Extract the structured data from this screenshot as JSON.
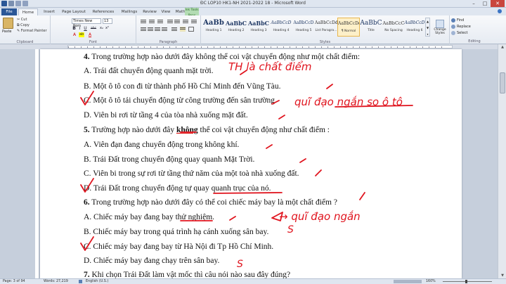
{
  "window": {
    "title": "ĐC LOP10 HK1-NH 2021-2022 18  -  Microsoft Word",
    "minimize": "–",
    "maximize": "□",
    "close": "✕"
  },
  "tabs": {
    "file": "File",
    "home": "Home",
    "insert": "Insert",
    "page_layout": "Page Layout",
    "references": "References",
    "mailings": "Mailings",
    "review": "Review",
    "view": "View",
    "mathtype": "MathType",
    "ink_tools": "Ink Tools",
    "pens": "Pens"
  },
  "ribbon": {
    "clipboard": {
      "paste": "Paste",
      "cut": "Cut",
      "copy": "Copy",
      "format_painter": "Format Painter",
      "label": "Clipboard"
    },
    "font": {
      "family": "Times New Rom",
      "size": "13",
      "label": "Font",
      "buttons": [
        "B",
        "I",
        "U",
        "abc",
        "x₂",
        "x²"
      ],
      "buttons2": [
        "A",
        "ab",
        "A"
      ]
    },
    "paragraph": {
      "label": "Paragraph"
    },
    "styles": {
      "label": "Styles",
      "items": [
        {
          "prev": "AaBb",
          "name": "Heading 1"
        },
        {
          "prev": "AaBbC",
          "name": "Heading 2"
        },
        {
          "prev": "AaBbC",
          "name": "Heading 3"
        },
        {
          "prev": "AaBbCcD",
          "name": "Heading 4"
        },
        {
          "prev": "AaBbCcD",
          "name": "Heading 5"
        },
        {
          "prev": "AaBbCcDd",
          "name": "List Paragra..."
        },
        {
          "prev": "AaBbCcDd",
          "name": "¶ Normal"
        },
        {
          "prev": "AaBbC",
          "name": "Title"
        },
        {
          "prev": "AaBbCcC",
          "name": "No Spacing"
        },
        {
          "prev": "AaBbCcD",
          "name": "Heading 6"
        }
      ],
      "change_styles": "Change Styles"
    },
    "editing": {
      "label": "Editing",
      "find": "Find",
      "replace": "Replace",
      "select": "Select"
    }
  },
  "document": {
    "lines": [
      {
        "prefix": "4.",
        "text": "  Trong trường hợp nào dưới đây không thể coi vật chuyển động như một chất điểm:"
      },
      {
        "text": "A. Trái đất chuyển động quanh mặt trời."
      },
      {
        "text": "B. Một ô tô con đi từ thành phố Hồ Chí Minh đến Vũng Tàu."
      },
      {
        "text": "C. Một ô tô tải chuyển động từ công trường đến sân trường."
      },
      {
        "text": "D. Viên bi rơi từ tầng 4 của tòa nhà xuống mặt đất."
      },
      {
        "prefix": "5.",
        "text_before": "  Trường hợp nào dưới đây ",
        "emph": "không",
        "text_after": " thể coi vật chuyển động như chất  điểm :"
      },
      {
        "text": "A. Viên đạn đang chuyển động trong không khí."
      },
      {
        "text": "B. Trái Đất trong chuyển động quay quanh Mặt Trời."
      },
      {
        "text": "C. Viên bi trong sự rơi từ tầng thứ năm của một toà nhà xuống đất."
      },
      {
        "text": "D. Trái Đất trong chuyển động tự quay quanh trục của nó."
      },
      {
        "prefix": "6.",
        "text": "  Trong trường hợp nào dưới đây có thể coi chiếc máy bay là một chất điểm ?"
      },
      {
        "text": "A. Chiếc máy bay đang bay thử nghiệm."
      },
      {
        "text": "B. Chiếc máy bay trong quá trình hạ cánh xuống sân bay."
      },
      {
        "text": "C. Chiếc máy bay đang bay từ  Hà Nội đi Tp Hồ Chí Minh."
      },
      {
        "text": "D. Chiếc máy bay đang chạy trên sân bay."
      },
      {
        "prefix": "7.",
        "text": "  Khi chọn Trái Đất làm vật mốc thì câu nói nào sau đây đúng?"
      }
    ],
    "handwriting": {
      "note1": "TH là chất điểm",
      "note2": "quĩ đạo ngắn so ô tô",
      "note3": "→ quĩ đạo ngắn",
      "s1": "S",
      "s2": "S"
    }
  },
  "status": {
    "page": "Page: 3 of 94",
    "words": "Words: 27,219",
    "language": "English (U.S.)",
    "zoom": "160%"
  },
  "colors": {
    "ink": "#e0141e",
    "file_tab": "#2b5797"
  }
}
